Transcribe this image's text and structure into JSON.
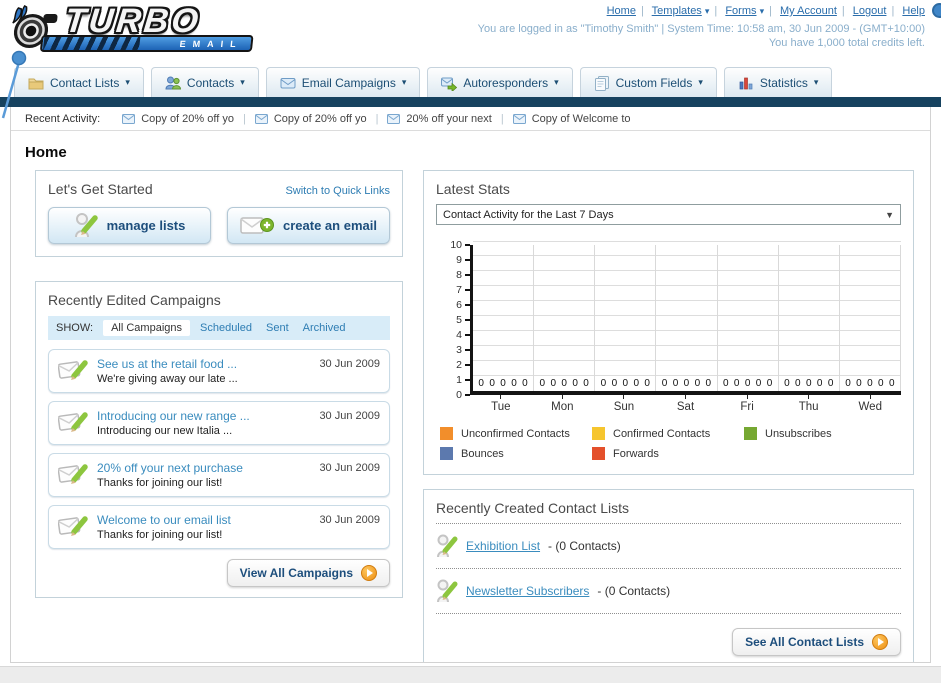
{
  "header": {
    "logo": {
      "title": "TURBO",
      "subtitle": "EMAIL"
    },
    "nav_links": [
      "Home",
      "Templates",
      "Forms",
      "My Account",
      "Logout",
      "Help"
    ],
    "login_info": "You are logged in as \"Timothy Smith\" | System Time: 10:58 am, 30 Jun 2009 - (GMT+10:00)",
    "credits_info": "You have 1,000 total credits left."
  },
  "nav": {
    "tabs": [
      "Contact Lists",
      "Contacts",
      "Email Campaigns",
      "Autoresponders",
      "Custom Fields",
      "Statistics"
    ]
  },
  "recent_activity": {
    "label": "Recent Activity:",
    "items": [
      "Copy of 20% off yo",
      "Copy of 20% off yo",
      "20% off your next",
      "Copy of Welcome to"
    ]
  },
  "page_title": "Home",
  "get_started": {
    "title": "Let's Get Started",
    "switch_link": "Switch to Quick Links",
    "manage_label": "manage lists",
    "create_label": "create an email"
  },
  "campaigns": {
    "title": "Recently Edited Campaigns",
    "show_label": "SHOW:",
    "filters": [
      "All Campaigns",
      "Scheduled",
      "Sent",
      "Archived"
    ],
    "active_filter": "All Campaigns",
    "items": [
      {
        "title": "See us at the retail food ...",
        "subtitle": "We're giving away our late ...",
        "date": "30 Jun 2009"
      },
      {
        "title": "Introducing our new range ...",
        "subtitle": "Introducing our new Italia ...",
        "date": "30 Jun 2009"
      },
      {
        "title": "20% off your next purchase",
        "subtitle": "Thanks for joining our list!",
        "date": "30 Jun 2009"
      },
      {
        "title": "Welcome to our email list",
        "subtitle": "Thanks for joining our list!",
        "date": "30 Jun 2009"
      }
    ],
    "view_all_label": "View All Campaigns"
  },
  "stats": {
    "title": "Latest Stats",
    "period": "Contact Activity for the Last 7 Days"
  },
  "chart_data": {
    "type": "bar",
    "title": "Contact Activity for the Last 7 Days",
    "categories": [
      "Tue",
      "Mon",
      "Sun",
      "Sat",
      "Fri",
      "Thu",
      "Wed"
    ],
    "series": [
      {
        "name": "Unconfirmed Contacts",
        "color": "#F28E2B",
        "values": [
          0,
          0,
          0,
          0,
          0,
          0,
          0
        ]
      },
      {
        "name": "Confirmed Contacts",
        "color": "#F6C52E",
        "values": [
          0,
          0,
          0,
          0,
          0,
          0,
          0
        ]
      },
      {
        "name": "Unsubscribes",
        "color": "#76A832",
        "values": [
          0,
          0,
          0,
          0,
          0,
          0,
          0
        ]
      },
      {
        "name": "Bounces",
        "color": "#5C79AE",
        "values": [
          0,
          0,
          0,
          0,
          0,
          0,
          0
        ]
      },
      {
        "name": "Forwards",
        "color": "#E4502B",
        "values": [
          0,
          0,
          0,
          0,
          0,
          0,
          0
        ]
      }
    ],
    "xlabel": "",
    "ylabel": "",
    "ylim": [
      0,
      10
    ],
    "ytick_step": 1,
    "grid": true,
    "legend_position": "bottom",
    "value_labels_shown": true
  },
  "contact_lists": {
    "title": "Recently Created Contact Lists",
    "items": [
      {
        "name": "Exhibition List",
        "suffix": "- (0 Contacts)"
      },
      {
        "name": "Newsletter Subscribers",
        "suffix": "- (0 Contacts)"
      }
    ],
    "see_all_label": "See All Contact Lists"
  },
  "colors": {
    "link_blue": "#2E7DB3",
    "navy_bar": "#16425F",
    "accent_orange": "#EE8F12"
  }
}
